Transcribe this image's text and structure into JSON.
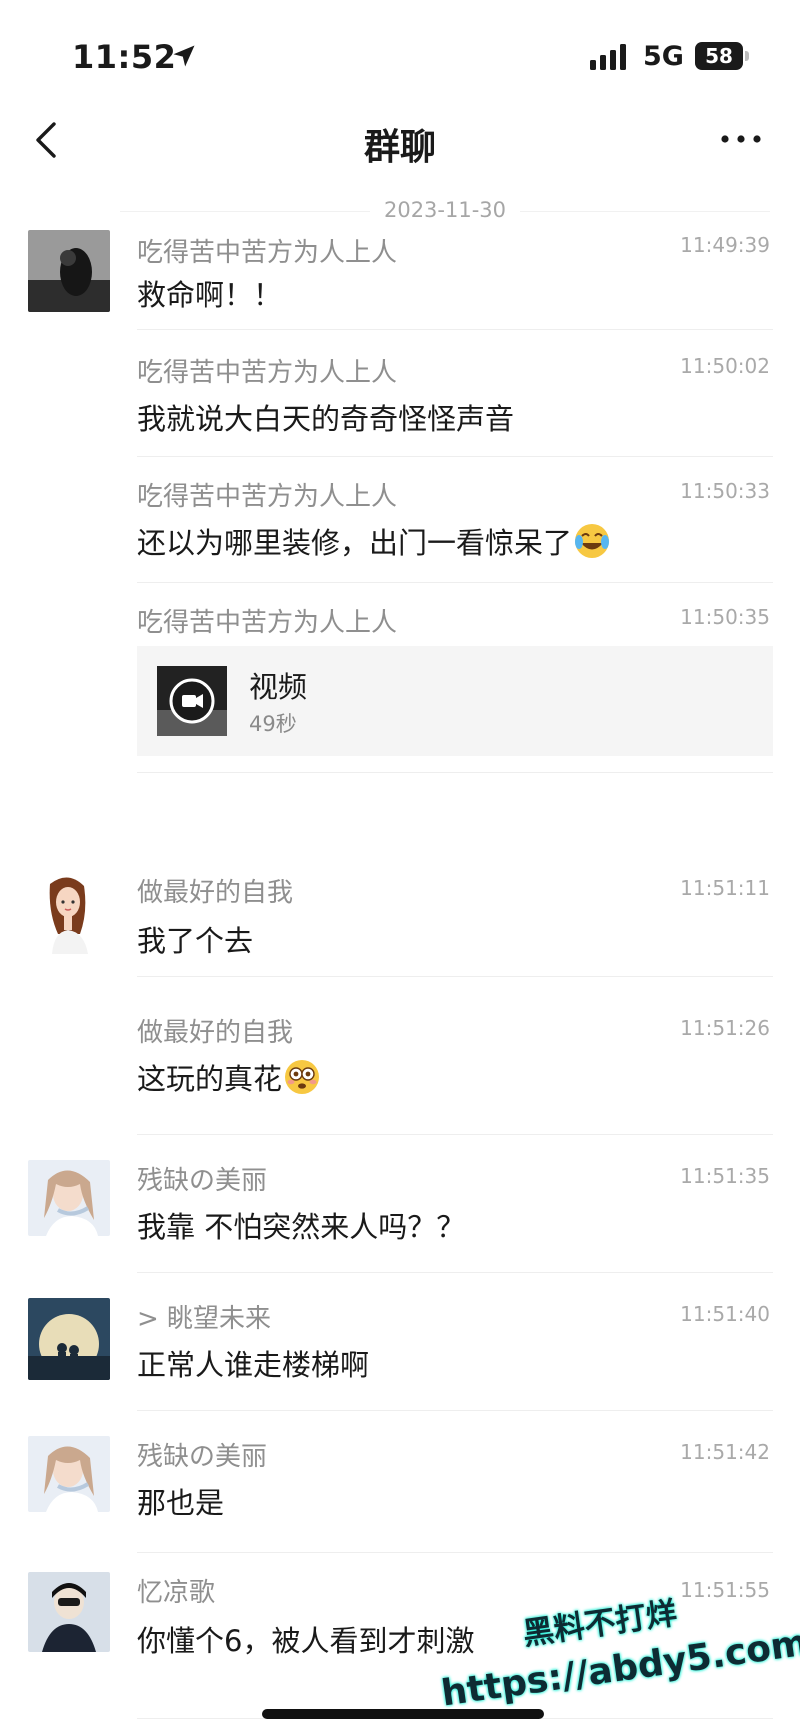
{
  "status_bar": {
    "time": "11:52",
    "network": "5G",
    "battery": "58"
  },
  "nav": {
    "title": "群聊"
  },
  "date_separator": "2023-11-30",
  "messages": [
    {
      "sender": "吃得苦中苦方为人上人",
      "time": "11:49:39",
      "text": "救命啊！！"
    },
    {
      "sender": "吃得苦中苦方为人上人",
      "time": "11:50:02",
      "text": "我就说大白天的奇奇怪怪声音"
    },
    {
      "sender": "吃得苦中苦方为人上人",
      "time": "11:50:33",
      "text": "还以为哪里装修，出门一看惊呆了"
    },
    {
      "sender": "吃得苦中苦方为人上人",
      "time": "11:50:35",
      "video_label": "视频",
      "video_duration": "49秒"
    },
    {
      "sender": "做最好的自我",
      "time": "11:51:11",
      "text": "我了个去"
    },
    {
      "sender": "做最好的自我",
      "time": "11:51:26",
      "text": "这玩的真花"
    },
    {
      "sender": "残缺の美丽",
      "time": "11:51:35",
      "text": "我靠 不怕突然来人吗？？"
    },
    {
      "sender": "> 眺望未来",
      "time": "11:51:40",
      "text": "正常人谁走楼梯啊"
    },
    {
      "sender": "残缺の美丽",
      "time": "11:51:42",
      "text": "那也是"
    },
    {
      "sender": "忆凉歌",
      "time": "11:51:55",
      "text": "你懂个6，被人看到才刺激"
    }
  ],
  "watermark": {
    "line1": "黑料不打烊",
    "line2": "https://abdy5.com"
  },
  "icons": {
    "location": "location-arrow-icon",
    "signal": "signal-icon",
    "back": "chevron-left-icon",
    "more": "more-dots-icon",
    "video": "video-camera-icon",
    "emoji_laugh": "laugh-cry-emoji",
    "emoji_shock": "flushed-emoji"
  }
}
